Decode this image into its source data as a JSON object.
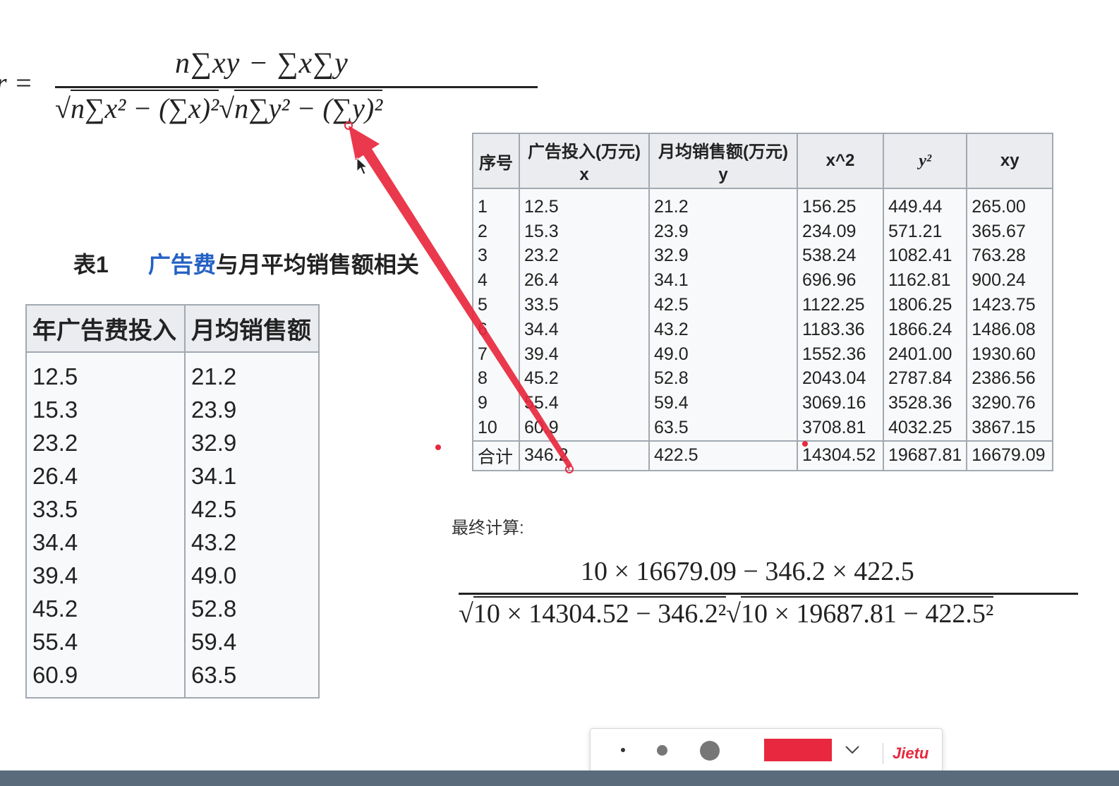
{
  "formula_top": {
    "r": "r =",
    "numerator": "n∑xy − ∑x∑y",
    "den_part1": "n∑x² − (∑x)²",
    "den_part2": "n∑y² − (∑y)²"
  },
  "table1": {
    "caption_num": "表1",
    "caption_link": "广告费",
    "caption_rest": "与月平均销售额相关",
    "headers": [
      "年广告费投入",
      "月均销售额"
    ],
    "rows": [
      [
        "12.5",
        "21.2"
      ],
      [
        "15.3",
        "23.9"
      ],
      [
        "23.2",
        "32.9"
      ],
      [
        "26.4",
        "34.1"
      ],
      [
        "33.5",
        "42.5"
      ],
      [
        "34.4",
        "43.2"
      ],
      [
        "39.4",
        "49.0"
      ],
      [
        "45.2",
        "52.8"
      ],
      [
        "55.4",
        "59.4"
      ],
      [
        "60.9",
        "63.5"
      ]
    ]
  },
  "table2": {
    "headers": {
      "idx": "序号",
      "x_top": "广告投入(万元)",
      "x_sub": "x",
      "y_top": "月均销售额(万元)",
      "y_sub": "y",
      "x2": "x^2",
      "y2": "y²",
      "xy": "xy"
    },
    "rows": [
      [
        "1",
        "12.5",
        "21.2",
        "156.25",
        "449.44",
        "265.00"
      ],
      [
        "2",
        "15.3",
        "23.9",
        "234.09",
        "571.21",
        "365.67"
      ],
      [
        "3",
        "23.2",
        "32.9",
        "538.24",
        "1082.41",
        "763.28"
      ],
      [
        "4",
        "26.4",
        "34.1",
        "696.96",
        "1162.81",
        "900.24"
      ],
      [
        "5",
        "33.5",
        "42.5",
        "1122.25",
        "1806.25",
        "1423.75"
      ],
      [
        "6",
        "34.4",
        "43.2",
        "1183.36",
        "1866.24",
        "1486.08"
      ],
      [
        "7",
        "39.4",
        "49.0",
        "1552.36",
        "2401.00",
        "1930.60"
      ],
      [
        "8",
        "45.2",
        "52.8",
        "2043.04",
        "2787.84",
        "2386.56"
      ],
      [
        "9",
        "55.4",
        "59.4",
        "3069.16",
        "3528.36",
        "3290.76"
      ],
      [
        "10",
        "60.9",
        "63.5",
        "3708.81",
        "4032.25",
        "3867.15"
      ]
    ],
    "total": [
      "合计",
      "346.2",
      "422.5",
      "14304.52",
      "19687.81",
      "16679.09"
    ]
  },
  "final": {
    "label": "最终计算:",
    "numerator": "10 × 16679.09 − 346.2 × 422.5",
    "den_part1": "10 × 14304.52 − 346.2²",
    "den_part2": "10 × 19687.81 − 422.5²"
  },
  "toolbar": {
    "brand": "Jietu",
    "selected_color": "#e8283e"
  }
}
